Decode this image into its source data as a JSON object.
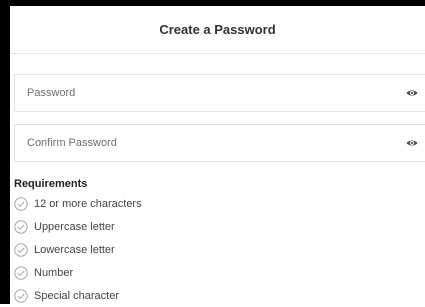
{
  "header": {
    "title": "Create a Password"
  },
  "fields": [
    {
      "placeholder": "Password",
      "value": "",
      "icon": "eye-icon"
    },
    {
      "placeholder": "Confirm Password",
      "value": "",
      "icon": "eye-icon"
    }
  ],
  "requirements": {
    "title": "Requirements",
    "items": [
      {
        "label": "12 or more characters",
        "met": false
      },
      {
        "label": "Uppercase letter",
        "met": false
      },
      {
        "label": "Lowercase letter",
        "met": false
      },
      {
        "label": "Number",
        "met": false
      },
      {
        "label": "Special character",
        "met": false
      }
    ]
  },
  "colors": {
    "icon": "#a7a7a7",
    "eye": "#555555",
    "border": "#e3e3e3"
  }
}
